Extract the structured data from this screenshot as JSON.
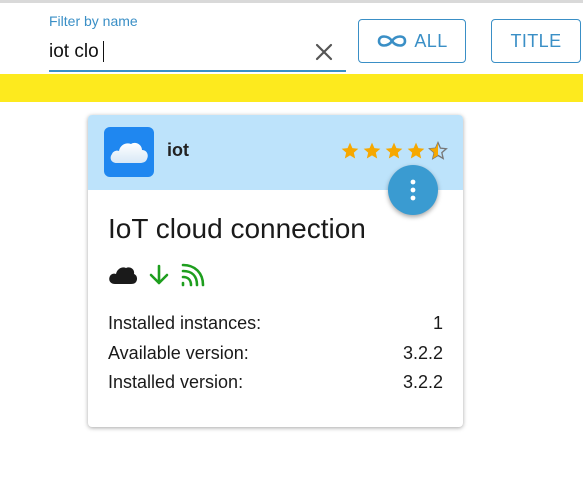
{
  "filter": {
    "label": "Filter by name",
    "value": "iot clo",
    "clear_icon": "close-icon"
  },
  "buttons": {
    "all_label": "ALL",
    "all_icon": "infinity-icon",
    "title_label": "TITLE"
  },
  "colors": {
    "accent": "#3a8fc6",
    "yellow_bar": "#fdea1e",
    "card_header": "#bde3fb",
    "star": "#f6a800",
    "status_green": "#1e9e1e"
  },
  "card": {
    "app_name": "iot",
    "title": "IoT cloud connection",
    "rating": 4.5,
    "rating_max": 5,
    "status_icons": [
      "cloud-icon",
      "arrow-down-icon",
      "signal-icon"
    ],
    "menu_icon": "more-vertical-icon",
    "info": [
      {
        "label": "Installed instances:",
        "value": "1"
      },
      {
        "label": "Available version:",
        "value": "3.2.2"
      },
      {
        "label": "Installed version:",
        "value": "3.2.2"
      }
    ]
  }
}
